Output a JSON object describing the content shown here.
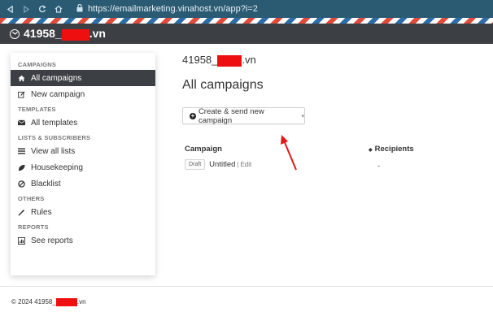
{
  "browser": {
    "url": "https://emailmarketing.vinahost.vn/app?i=2"
  },
  "header": {
    "brand_prefix": "41958_",
    "brand_suffix": ".vn"
  },
  "sidebar": {
    "sections": [
      {
        "heading": "CAMPAIGNS",
        "items": [
          {
            "label": "All campaigns",
            "icon": "home-icon",
            "active": true
          },
          {
            "label": "New campaign",
            "icon": "edit-icon"
          }
        ]
      },
      {
        "heading": "TEMPLATES",
        "items": [
          {
            "label": "All templates",
            "icon": "envelope-icon"
          }
        ]
      },
      {
        "heading": "LISTS & SUBSCRIBERS",
        "items": [
          {
            "label": "View all lists",
            "icon": "list-icon"
          },
          {
            "label": "Housekeeping",
            "icon": "leaf-icon"
          },
          {
            "label": "Blacklist",
            "icon": "ban-icon"
          }
        ]
      },
      {
        "heading": "OTHERS",
        "items": [
          {
            "label": "Rules",
            "icon": "wand-icon"
          }
        ]
      },
      {
        "heading": "REPORTS",
        "items": [
          {
            "label": "See reports",
            "icon": "bar-chart-icon"
          }
        ]
      }
    ]
  },
  "main": {
    "account_prefix": "41958_",
    "account_suffix": ".vn",
    "page_title": "All campaigns",
    "create_button_label": "Create & send new campaign",
    "columns": {
      "campaign": "Campaign",
      "recipients": "Recipients"
    },
    "rows": [
      {
        "status": "Draft",
        "name": "Untitled",
        "separator": "|",
        "edit_label": "Edit",
        "recipients": "-"
      }
    ]
  },
  "footer": {
    "prefix": "© 2024 41958_",
    "suffix": ".vn"
  },
  "colors": {
    "header_bg": "#3c4045",
    "browser_bg": "#2b5a73",
    "redaction": "#ee1010",
    "annotation_arrow": "#e01818"
  }
}
